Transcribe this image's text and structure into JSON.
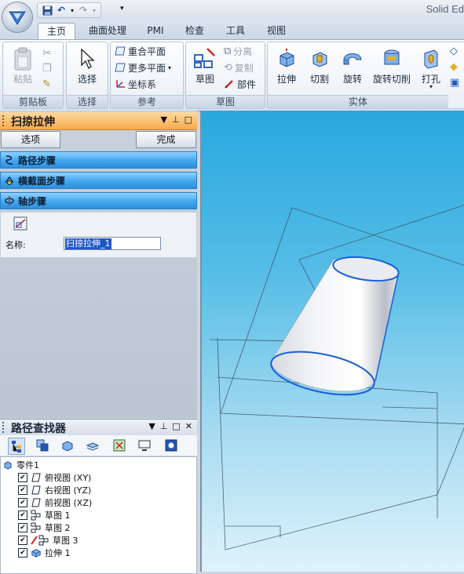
{
  "window": {
    "title": "Solid Ed"
  },
  "tabs": [
    "主页",
    "曲面处理",
    "PMI",
    "检查",
    "工具",
    "视图"
  ],
  "ribbon": {
    "clipboard": {
      "group_label": "剪贴板",
      "paste": "粘贴"
    },
    "select": {
      "group_label": "选择",
      "select": "选择"
    },
    "reference": {
      "group_label": "参考",
      "coincident_plane": "重合平面",
      "more_planes": "更多平面",
      "coordinate_system": "坐标系"
    },
    "sketch": {
      "group_label": "草图",
      "sketch": "草图",
      "separate": "分离",
      "copy": "复制",
      "part": "部件"
    },
    "solid": {
      "group_label": "实体",
      "extrude": "拉伸",
      "cut": "切割",
      "revolve": "旋转",
      "revolve_cut": "旋转切削",
      "hole": "打孔"
    }
  },
  "sweep_panel": {
    "title": "扫掠拉伸",
    "options_button": "选项",
    "finish_button": "完成",
    "steps": [
      "路径步骤",
      "横截面步骤",
      "轴步骤"
    ],
    "name_label": "名称:",
    "name_value": "扫掠拉伸_1"
  },
  "path_finder": {
    "title": "路径查找器",
    "root": "零件1",
    "items": [
      {
        "label": "俯视图 (XY)",
        "icon": "plane-icon",
        "checked": true
      },
      {
        "label": "右视图 (YZ)",
        "icon": "plane-icon",
        "checked": true
      },
      {
        "label": "前视图 (XZ)",
        "icon": "plane-icon",
        "checked": true
      },
      {
        "label": "草图 1",
        "icon": "sketch-icon",
        "checked": true
      },
      {
        "label": "草图 2",
        "icon": "sketch-icon",
        "checked": true
      },
      {
        "label": "草图 3",
        "icon": "sketch-edit-icon",
        "checked": true
      },
      {
        "label": "拉伸 1",
        "icon": "extrude-icon",
        "checked": true
      }
    ]
  },
  "colors": {
    "accent_orange": "#f6a94a",
    "step_blue": "#42a6ee",
    "viewport_top": "#28a8df",
    "edge_blue": "#1a5fd6"
  }
}
